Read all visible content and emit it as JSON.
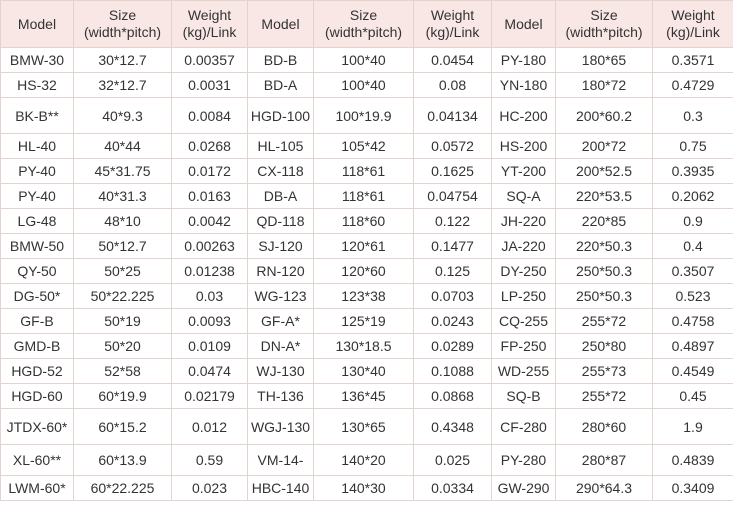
{
  "table": {
    "headers": [
      {
        "l1": "Model",
        "l2": ""
      },
      {
        "l1": "Size",
        "l2": "(width*pitch)"
      },
      {
        "l1": "Weight",
        "l2": "(kg)/Link"
      },
      {
        "l1": "Model",
        "l2": ""
      },
      {
        "l1": "Size",
        "l2": "(width*pitch)"
      },
      {
        "l1": "Weight",
        "l2": "(kg)/Link"
      },
      {
        "l1": "Model",
        "l2": ""
      },
      {
        "l1": "Size",
        "l2": "(width*pitch)"
      },
      {
        "l1": "Weight",
        "l2": "(kg)/Link"
      }
    ],
    "rows": [
      [
        "BMW-30",
        "30*12.7",
        "0.00357",
        "BD-B",
        "100*40",
        "0.0454",
        "PY-180",
        "180*65",
        "0.3571"
      ],
      [
        "HS-32",
        "32*12.7",
        "0.0031",
        "BD-A",
        "100*40",
        "0.08",
        "YN-180",
        "180*72",
        "0.4729"
      ],
      [
        "BK-B**",
        "40*9.3",
        "0.0084",
        "HGD-100",
        "100*19.9",
        "0.04134",
        "HC-200",
        "200*60.2",
        "0.3"
      ],
      [
        "HL-40",
        "40*44",
        "0.0268",
        "HL-105",
        "105*42",
        "0.0572",
        "HS-200",
        "200*72",
        "0.75"
      ],
      [
        "PY-40",
        "45*31.75",
        "0.0172",
        "CX-118",
        "118*61",
        "0.1625",
        "YT-200",
        "200*52.5",
        "0.3935"
      ],
      [
        "PY-40",
        "40*31.3",
        "0.0163",
        "DB-A",
        "118*61",
        "0.04754",
        "SQ-A",
        "220*53.5",
        "0.2062"
      ],
      [
        "LG-48",
        "48*10",
        "0.0042",
        "QD-118",
        "118*60",
        "0.122",
        "JH-220",
        "220*85",
        "0.9"
      ],
      [
        "BMW-50",
        "50*12.7",
        "0.00263",
        "SJ-120",
        "120*61",
        "0.1477",
        "JA-220",
        "220*50.3",
        "0.4"
      ],
      [
        "QY-50",
        "50*25",
        "0.01238",
        "RN-120",
        "120*60",
        "0.125",
        "DY-250",
        "250*50.3",
        "0.3507"
      ],
      [
        "DG-50*",
        "50*22.225",
        "0.03",
        "WG-123",
        "123*38",
        "0.0703",
        "LP-250",
        "250*50.3",
        "0.523"
      ],
      [
        "GF-B",
        "50*19",
        "0.0093",
        "GF-A*",
        "125*19",
        "0.0243",
        "CQ-255",
        "255*72",
        "0.4758"
      ],
      [
        "GMD-B",
        "50*20",
        "0.0109",
        "DN-A*",
        "130*18.5",
        "0.0289",
        "FP-250",
        "250*80",
        "0.4897"
      ],
      [
        "HGD-52",
        "52*58",
        "0.0474",
        "WJ-130",
        "130*40",
        "0.1088",
        "WD-255",
        "255*73",
        "0.4549"
      ],
      [
        "HGD-60",
        "60*19.9",
        "0.02179",
        "TH-136",
        "136*45",
        "0.0868",
        "SQ-B",
        "255*72",
        "0.45"
      ],
      [
        "JTDX-60*",
        "60*15.2",
        "0.012",
        "WGJ-130",
        "130*65",
        "0.4348",
        "CF-280",
        "280*60",
        "1.9"
      ],
      [
        "XL-60**",
        "60*13.9",
        "0.59",
        "VM-14-",
        "140*20",
        "0.025",
        "PY-280",
        "280*87",
        "0.4839"
      ],
      [
        "LWM-60*",
        "60*22.225",
        "0.023",
        "HBC-140",
        "140*30",
        "0.0334",
        "GW-290",
        "290*64.3",
        "0.3409"
      ]
    ]
  }
}
